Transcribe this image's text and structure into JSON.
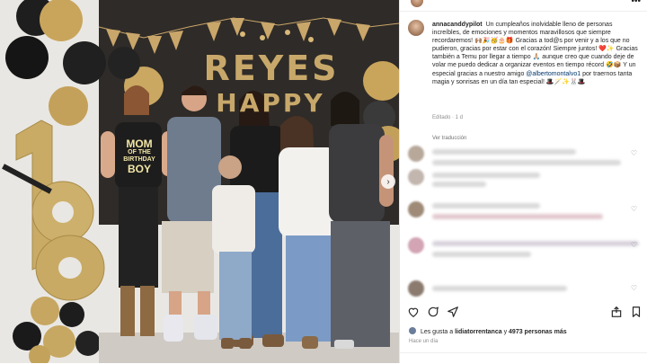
{
  "photo": {
    "banner_line1": "REYES",
    "banner_line2": "HAPPY",
    "shirt_line1": "MOM",
    "shirt_line2": "OF THE",
    "shirt_line3": "BIRTHDAY",
    "shirt_line4": "BOY",
    "carousel_indicator": "›"
  },
  "post": {
    "username": "annacanddypilot",
    "caption_parts": [
      "Un cumpleaños inolvidable lleno de personas increíbles, de emociones y momentos maravillosos que siempre recordaremos! 🙌🏽🎉🥳🎂🎁",
      "Gracias a tod@s por venir y a los que no pudieron, gracias por estar con el corazón! Siempre juntos! ❤️✨",
      "Gracias también a Temu por llegar a tiempo 🙏🏼 aunque creo que cuando deje de volar me puedo dedicar a organizar eventos en tiempo récord 🤣📦 Y un especial gracias a nuestro amigo",
      "@albertomontalvo1",
      "por traernos tanta magia y sonrisas en un día tan especial! 🎩🪄✨🐰🎩"
    ],
    "caption_meta": "Editado · 1 d",
    "see_translation": "Ver traducción",
    "likes_prefix": "Les gusta a",
    "likes_user": "lidiatorrentanca",
    "likes_connector": "y",
    "likes_count": "4973 personas más",
    "time_ago": "Hace un día"
  },
  "icons": [
    "heart-icon",
    "comment-icon",
    "share-icon",
    "save-icon",
    "more-icon"
  ],
  "colors": {
    "mention": "#00376b",
    "meta": "#8e8e8e",
    "text": "#262626"
  }
}
